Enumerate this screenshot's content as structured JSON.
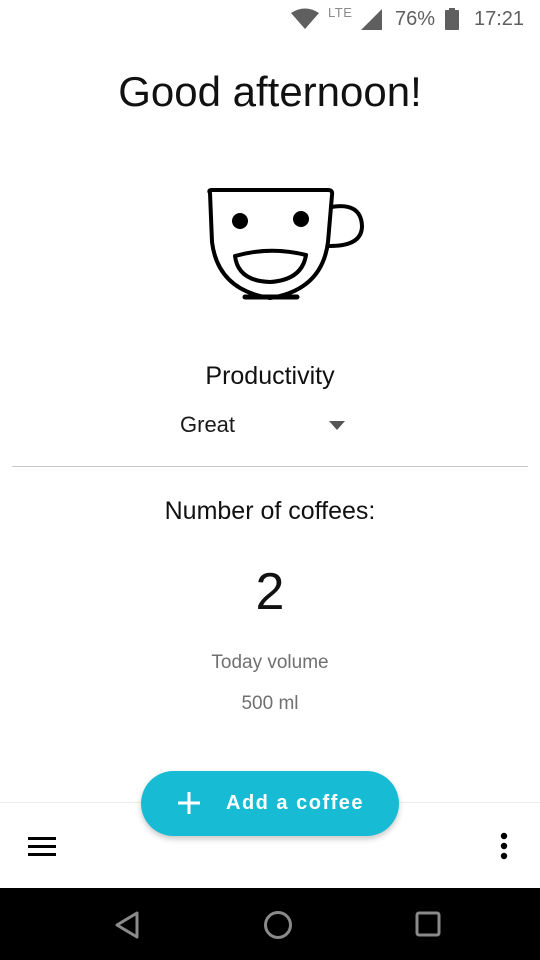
{
  "status_bar": {
    "network_label": "LTE",
    "battery_percent": "76%",
    "time": "17:21",
    "icons": [
      "wifi-icon",
      "cell-signal-icon",
      "battery-icon"
    ]
  },
  "greeting": "Good afternoon!",
  "mascot_icon": "smiling-coffee-cup-icon",
  "productivity": {
    "label": "Productivity",
    "selected": "Great"
  },
  "coffees": {
    "label": "Number of coffees:",
    "count": "2",
    "volume_label": "Today volume",
    "volume_value": "500 ml"
  },
  "fab": {
    "icon": "plus-icon",
    "label": "Add a coffee",
    "color": "#17bcd4"
  },
  "bottom_bar": {
    "icons": [
      "hamburger-menu-icon",
      "more-vert-icon"
    ]
  },
  "nav_bar": {
    "icons": [
      "back-icon",
      "home-icon",
      "recents-icon"
    ]
  }
}
